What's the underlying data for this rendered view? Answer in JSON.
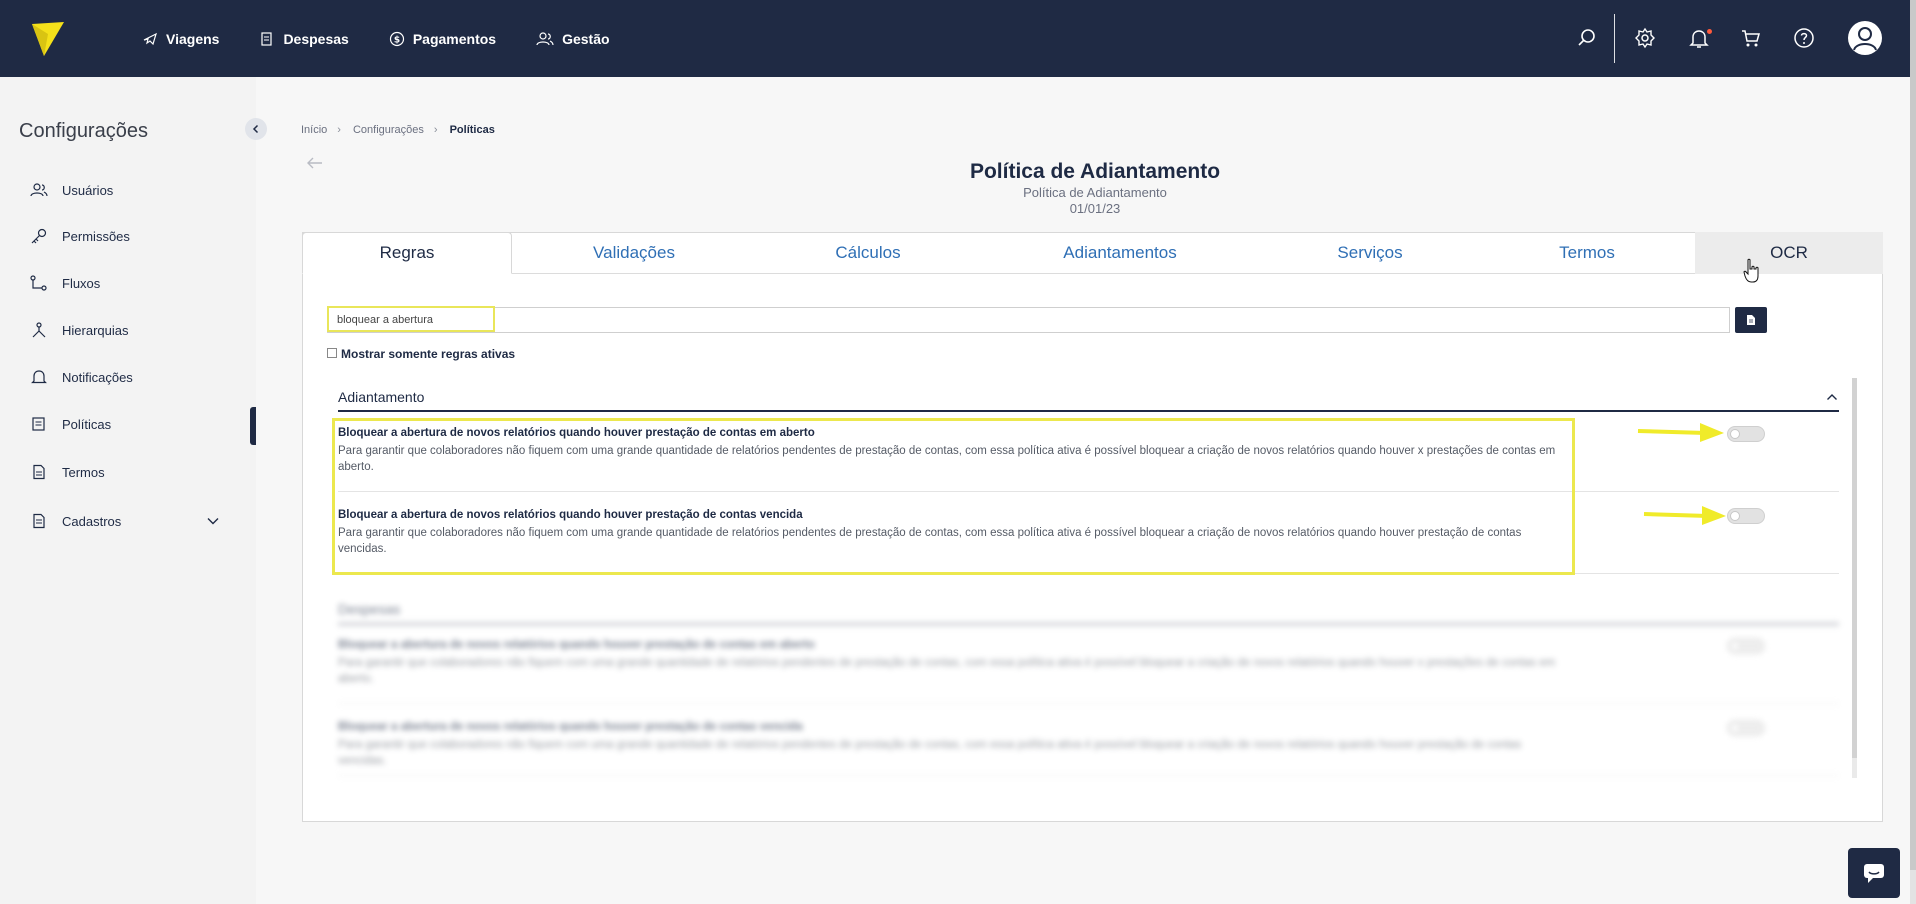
{
  "nav": {
    "items": [
      {
        "label": "Viagens",
        "icon": "plane-icon"
      },
      {
        "label": "Despesas",
        "icon": "receipt-icon"
      },
      {
        "label": "Pagamentos",
        "icon": "dollar-icon"
      },
      {
        "label": "Gestão",
        "icon": "users-icon"
      }
    ],
    "right_icons": [
      "search-icon",
      "gear-icon",
      "bell-icon",
      "cart-icon",
      "help-icon",
      "user-avatar-icon"
    ]
  },
  "sidebar": {
    "title": "Configurações",
    "items": [
      {
        "label": "Usuários",
        "icon": "users-icon"
      },
      {
        "label": "Permissões",
        "icon": "key-icon"
      },
      {
        "label": "Fluxos",
        "icon": "flow-icon"
      },
      {
        "label": "Hierarquias",
        "icon": "hierarchy-icon"
      },
      {
        "label": "Notificações",
        "icon": "bell-icon"
      },
      {
        "label": "Políticas",
        "icon": "policy-icon"
      },
      {
        "label": "Termos",
        "icon": "document-icon"
      },
      {
        "label": "Cadastros",
        "icon": "register-icon"
      }
    ],
    "active": "Políticas"
  },
  "breadcrumb": [
    "Início",
    "Configurações",
    "Políticas"
  ],
  "page": {
    "title": "Política de Adiantamento",
    "subtitle": "Política de Adiantamento",
    "date": "01/01/23"
  },
  "tabs": [
    "Regras",
    "Validações",
    "Cálculos",
    "Adiantamentos",
    "Serviços",
    "Termos",
    "OCR"
  ],
  "active_tab": "Regras",
  "search": {
    "value": "bloquear a abertura",
    "placeholder": ""
  },
  "filter": {
    "label": "Mostrar somente regras ativas",
    "checked": false
  },
  "sections": [
    {
      "title": "Adiantamento",
      "rules": [
        {
          "title": "Bloquear a abertura de novos relatórios quando houver prestação de contas em aberto",
          "description": "Para garantir que colaboradores não fiquem com uma grande quantidade de relatórios pendentes de prestação de contas, com essa política ativa é possível bloquear a criação de novos relatórios quando houver x prestações de contas em aberto.",
          "enabled": false
        },
        {
          "title": "Bloquear a abertura de novos relatórios quando houver prestação de contas vencida",
          "description": "Para garantir que colaboradores não fiquem com uma grande quantidade de relatórios pendentes de prestação de contas, com essa política ativa é possível bloquear a criação de novos relatórios quando houver prestação de contas vencidas.",
          "enabled": false
        }
      ]
    },
    {
      "title": "Despesas",
      "rules": [
        {
          "title": "Bloquear a abertura de novos relatórios quando houver prestação de contas em aberto",
          "description": "Para garantir que colaboradores não fiquem com uma grande quantidade de relatórios pendentes de prestação de contas, com essa política ativa é possível bloquear a criação de novos relatórios quando houver x prestações de contas em aberto.",
          "enabled": false
        },
        {
          "title": "Bloquear a abertura de novos relatórios quando houver prestação de contas vencida",
          "description": "Para garantir que colaboradores não fiquem com uma grande quantidade de relatórios pendentes de prestação de contas, com essa política ativa é possível bloquear a criação de novos relatórios quando houver prestação de contas vencidas.",
          "enabled": false
        }
      ]
    }
  ],
  "colors": {
    "topbar": "#1f2a44",
    "accent_tab": "#2f6fb5",
    "highlight": "#ece84e",
    "logo": "#f5e11a"
  }
}
